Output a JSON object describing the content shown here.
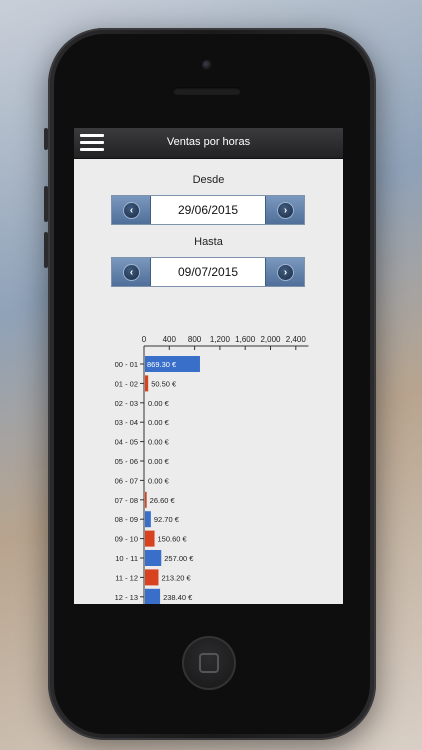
{
  "navbar": {
    "title": "Ventas por horas",
    "menu_icon": "hamburger-menu-icon"
  },
  "filters": {
    "desde_label": "Desde",
    "desde_value": "29/06/2015",
    "hasta_label": "Hasta",
    "hasta_value": "09/07/2015",
    "prev_icon": "chevron-left-icon",
    "next_icon": "chevron-right-icon"
  },
  "colors": {
    "blue": "#3a6fc9",
    "red": "#d9421f",
    "accent": "#4f6f9a"
  },
  "chart_data": {
    "type": "bar",
    "orientation": "horizontal",
    "x_ticks": [
      "0",
      "400",
      "800",
      "1,200",
      "1,600",
      "2,000",
      "2,400"
    ],
    "xlim": [
      0,
      2600
    ],
    "categories": [
      "00 - 01",
      "01 - 02",
      "02 - 03",
      "03 - 04",
      "04 - 05",
      "05 - 06",
      "06 - 07",
      "07 - 08",
      "08 - 09",
      "09 - 10",
      "10 - 11",
      "11 - 12",
      "12 - 13"
    ],
    "values": [
      869.3,
      50.5,
      0.0,
      0.0,
      0.0,
      0.0,
      0.0,
      26.6,
      92.7,
      150.6,
      257.0,
      213.2,
      238.4
    ],
    "labels": [
      "869.30 €",
      "50.50 €",
      "0.00 €",
      "0.00 €",
      "0.00 €",
      "0.00 €",
      "0.00 €",
      "26.60 €",
      "92.70 €",
      "150.60 €",
      "257.00 €",
      "213.20 €",
      "238.40 €"
    ],
    "colors": [
      "blue",
      "red",
      "blue",
      "red",
      "blue",
      "red",
      "blue",
      "red",
      "blue",
      "red",
      "blue",
      "red",
      "blue"
    ]
  }
}
